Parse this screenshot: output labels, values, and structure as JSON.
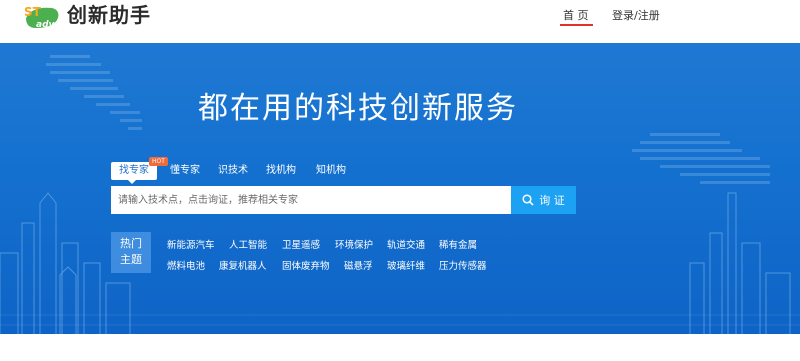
{
  "brand": {
    "logo_text": "ST",
    "logo_sub": "adv",
    "name": "创新助手"
  },
  "nav": {
    "home": "首 页",
    "login": "登录/注册"
  },
  "hero": {
    "title": "都在用的科技创新服务",
    "tabs": [
      "找专家",
      "懂专家",
      "识技术",
      "找机构",
      "知机构"
    ],
    "hot_badge": "HOT",
    "search": {
      "placeholder": "请输入技术点，点击询证，推荐相关专家",
      "button": "询 证"
    },
    "hot_label_line1": "热门",
    "hot_label_line2": "主题",
    "topics_row1": [
      "新能源汽车",
      "人工智能",
      "卫星遥感",
      "环境保护",
      "轨道交通",
      "稀有金属"
    ],
    "topics_row2": [
      "燃料电池",
      "康复机器人",
      "固体废弃物",
      "磁悬浮",
      "玻璃纤维",
      "压力传感器"
    ]
  },
  "colors": {
    "hero_bg": "#1470cf",
    "search_button": "#1da1f2",
    "nav_underline": "#e0312a",
    "hot_badge": "#ef6a3c"
  }
}
